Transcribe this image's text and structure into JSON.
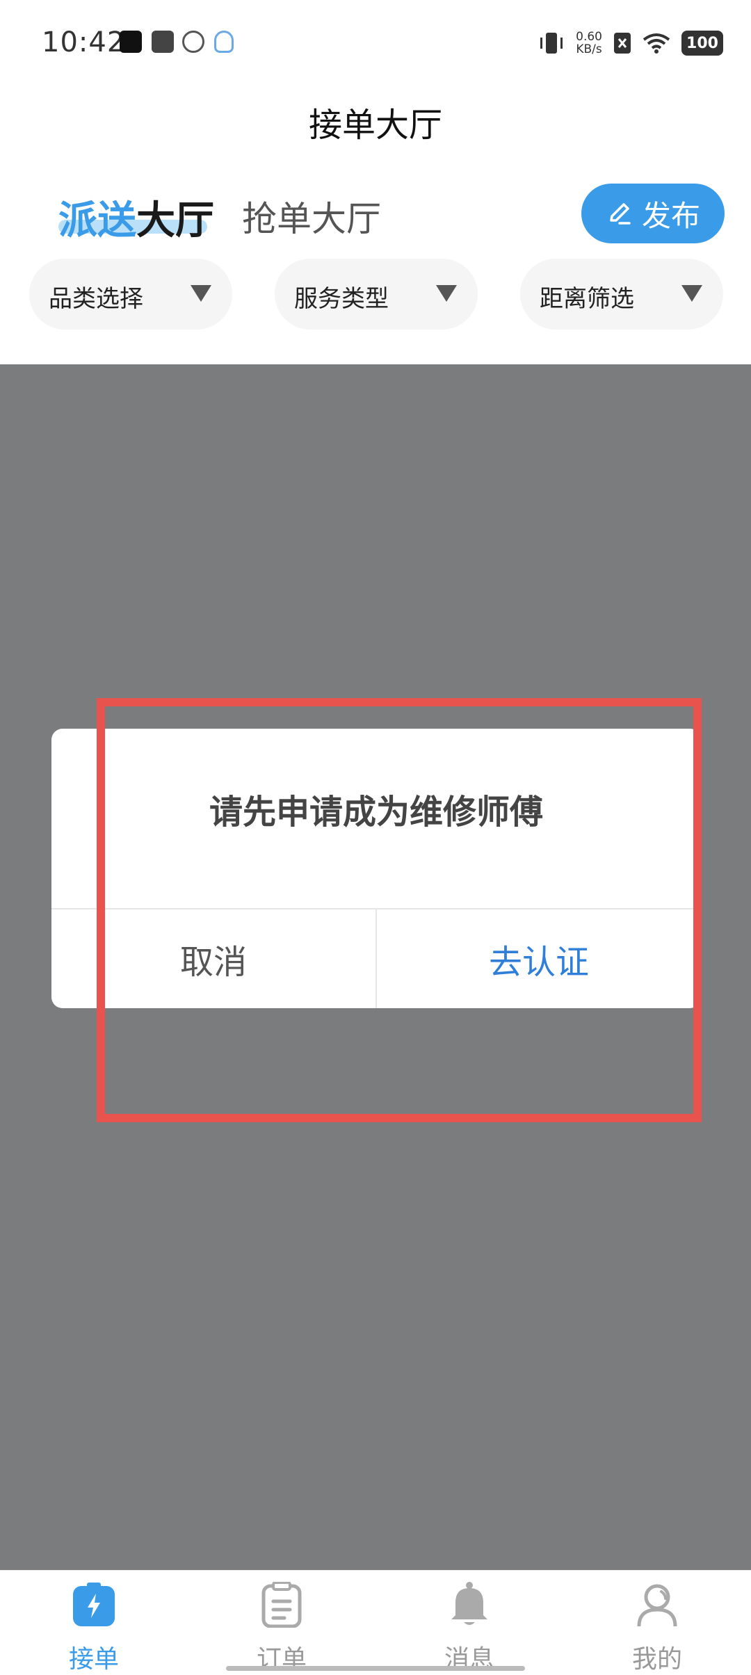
{
  "status_bar": {
    "time": "10:42",
    "net_speed_value": "0.60",
    "net_speed_unit": "KB/s",
    "battery": "100"
  },
  "header": {
    "title": "接单大厅"
  },
  "tabs": {
    "dispatch_part1": "派送",
    "dispatch_part2": "大厅",
    "grab": "抢单大厅",
    "active": "dispatch"
  },
  "publish_button": {
    "label": "发布",
    "icon": "pencil-icon"
  },
  "filters": [
    {
      "label": "品类选择"
    },
    {
      "label": "服务类型"
    },
    {
      "label": "距离筛选"
    }
  ],
  "dialog": {
    "title": "请先申请成为维修师傅",
    "cancel_label": "取消",
    "confirm_label": "去认证"
  },
  "bottom_nav": [
    {
      "label": "接单",
      "icon": "lightning-icon",
      "active": true
    },
    {
      "label": "订单",
      "icon": "clipboard-icon",
      "active": false
    },
    {
      "label": "消息",
      "icon": "bell-icon",
      "active": false
    },
    {
      "label": "我的",
      "icon": "user-icon",
      "active": false
    }
  ],
  "colors": {
    "accent": "#3a9be8",
    "overlay": "#7b7c7e",
    "confirm": "#2f7fd9",
    "highlight": "#e9534e"
  }
}
